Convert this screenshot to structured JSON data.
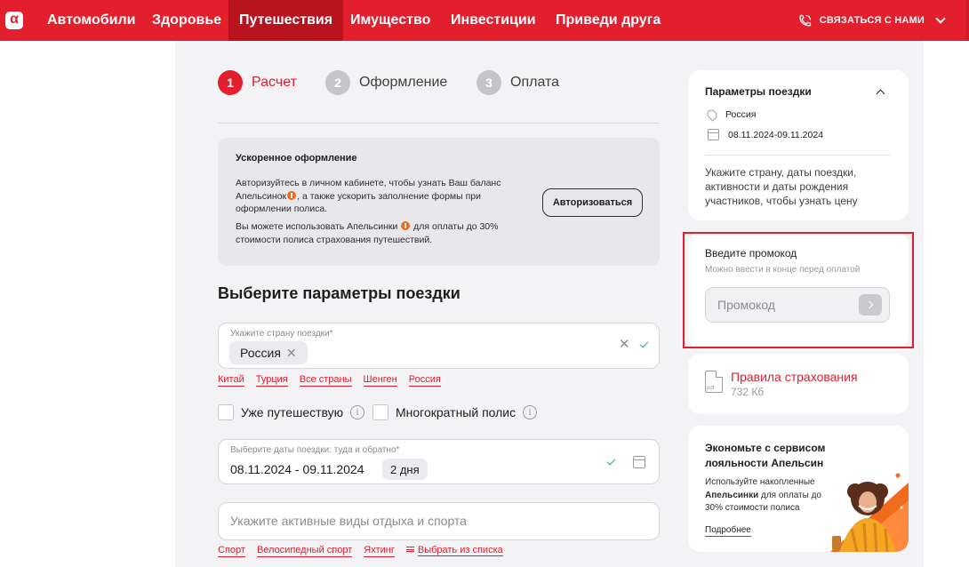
{
  "nav": {
    "logo_letter": "α",
    "items": [
      "Автомобили",
      "Здоровье",
      "Путешествия",
      "Имущество",
      "Инвестиции",
      "Приведи друга"
    ],
    "active_index": 2,
    "contact": "СВЯЗАТЬСЯ С НАМИ"
  },
  "steps": [
    {
      "num": "1",
      "label": "Расчет",
      "active": true
    },
    {
      "num": "2",
      "label": "Оформление",
      "active": false
    },
    {
      "num": "3",
      "label": "Оплата",
      "active": false
    }
  ],
  "fast": {
    "title": "Ускоренное оформление",
    "p1_a": "Авторизуйтесь в личном кабинете, чтобы узнать Ваш баланс Апельсинок",
    "p1_b": ", а также ускорить заполнение формы при оформлении полиса.",
    "p2_a": "Вы можете использовать Апельсинки",
    "p2_b": " для оплаты до 30% стоимости полиса страхования путешествий.",
    "button": "Авторизоваться"
  },
  "params": {
    "title": "Выберите параметры поездки",
    "country": {
      "label": "Укажите страну поездки*",
      "chip": "Россия",
      "quick_links": [
        "Китай",
        "Турция",
        "Все страны",
        "Шенген",
        "Россия"
      ]
    },
    "checkboxes": [
      "Уже путешествую",
      "Многократный полис"
    ],
    "dates": {
      "label": "Выберите даты поездки: туда и обратно*",
      "value": "08.11.2024 - 09.11.2024",
      "duration": "2 дня"
    },
    "activities": {
      "placeholder": "Укажите активные виды отдыха и спорта",
      "quick_links": [
        "Спорт",
        "Велосипедный спорт",
        "Яхтинг"
      ],
      "choose_link": "Выбрать из списка"
    }
  },
  "sidebar": {
    "trip": {
      "title": "Параметры поездки",
      "country": "Россия",
      "dates": "08.11.2024-09.11.2024",
      "note": "Укажите страну, даты поездки, активности и даты рождения участников, чтобы узнать цену"
    },
    "promo": {
      "title": "Введите промокод",
      "subtitle": "Можно ввести в конце перед оплатой",
      "placeholder": "Промокод"
    },
    "rules": {
      "link": "Правила страхования",
      "size": "732 Кб",
      "file_badge": "pdf"
    },
    "loyalty": {
      "title": "Экономьте с сервисом лояльности Апельсин",
      "text_a": "Используйте накопленные ",
      "text_bold": "Апельсинки",
      "text_b": " для оплаты до 30% стоимости полиса",
      "link": "Подробнее"
    }
  },
  "colors": {
    "brand_red": "#e31e2d",
    "orange": "#f26a1b",
    "ok_green": "#26b36b"
  }
}
